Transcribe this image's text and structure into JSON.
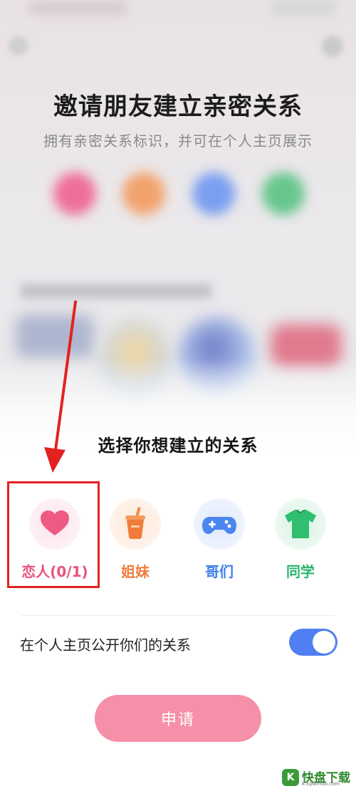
{
  "background": {
    "title": "邀请朋友建立亲密关系",
    "subtitle": "拥有亲密关系标识，并可在个人主页展示"
  },
  "sheet": {
    "title": "选择你想建立的关系",
    "relationships": [
      {
        "label": "恋人(0/1)",
        "icon": "heart-icon",
        "color": "#e8537c",
        "selected": true
      },
      {
        "label": "姐妹",
        "icon": "cup-icon",
        "color": "#ef7b3b",
        "selected": false
      },
      {
        "label": "哥们",
        "icon": "gamepad-icon",
        "color": "#3f7ee8",
        "selected": false
      },
      {
        "label": "同学",
        "icon": "shirt-icon",
        "color": "#2bb56a",
        "selected": false
      }
    ],
    "public_toggle": {
      "label": "在个人主页公开你们的关系",
      "on": true
    },
    "apply_button": "申请"
  },
  "watermark": {
    "logo": "K",
    "text": "快盘下载",
    "sub": "k.kpwmob.com"
  }
}
